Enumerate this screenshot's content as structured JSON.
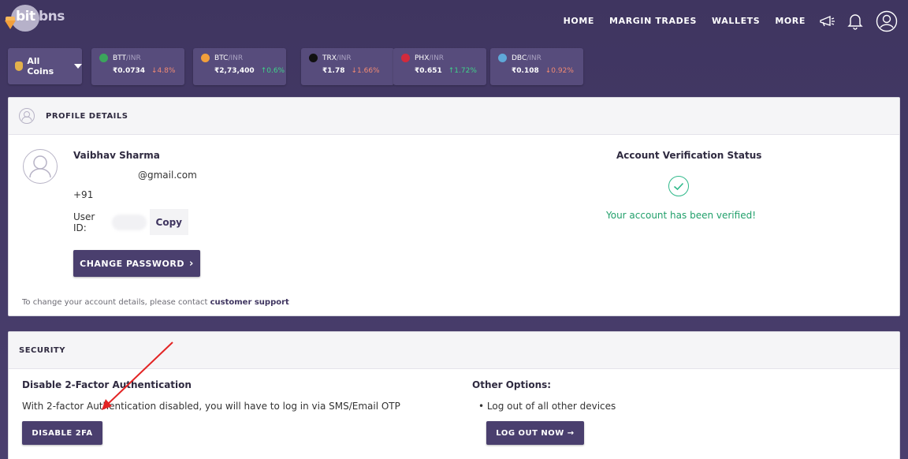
{
  "brand": {
    "logo_left": "bit",
    "logo_right": "bns"
  },
  "nav": {
    "items": [
      "HOME",
      "MARGIN TRADES",
      "WALLETS",
      "MORE"
    ],
    "icons": [
      "megaphone-icon",
      "bell-icon",
      "user-icon"
    ]
  },
  "coins_filter": {
    "label": "All Coins"
  },
  "tickers": [
    {
      "symbol": "BTT",
      "quote": "INR",
      "price": "₹0.0734",
      "change": "↓4.8%",
      "dir": "down",
      "color": "#3ba55c"
    },
    {
      "symbol": "BTC",
      "quote": "INR",
      "price": "₹2,73,400",
      "change": "↑0.6%",
      "dir": "up",
      "color": "#f29f3b"
    },
    {
      "symbol": "TRX",
      "quote": "INR",
      "price": "₹1.78",
      "change": "↓1.66%",
      "dir": "down",
      "color": "#111111"
    },
    {
      "symbol": "PHX",
      "quote": "INR",
      "price": "₹0.651",
      "change": "↑1.72%",
      "dir": "up",
      "color": "#d22a3c"
    },
    {
      "symbol": "DBC",
      "quote": "INR",
      "price": "₹0.108",
      "change": "↓0.92%",
      "dir": "down",
      "color": "#5fa8d8"
    }
  ],
  "profile": {
    "header": "PROFILE DETAILS",
    "name": "Vaibhav Sharma",
    "email": "@gmail.com",
    "phone": "+91",
    "user_id_label": "User ID:",
    "copy_label": "Copy",
    "change_password_label": "CHANGE PASSWORD",
    "note_prefix": "To change your account details, please contact ",
    "note_link": "customer support",
    "verification_title": "Account Verification Status",
    "verification_message": "Your account has been verified!"
  },
  "security": {
    "header": "SECURITY",
    "twofa_title": "Disable 2-Factor Authentication",
    "twofa_desc": "With 2-factor Authentication disabled, you will have to log in via SMS/Email OTP",
    "disable_label": "DISABLE 2FA",
    "other_title": "Other Options:",
    "other_item": "• Log out of all other devices",
    "logout_label": "LOG OUT NOW →"
  },
  "colors": {
    "brand_purple": "#4a3f6e",
    "success": "#22a06b",
    "annotation_arrow": "#e32424"
  }
}
